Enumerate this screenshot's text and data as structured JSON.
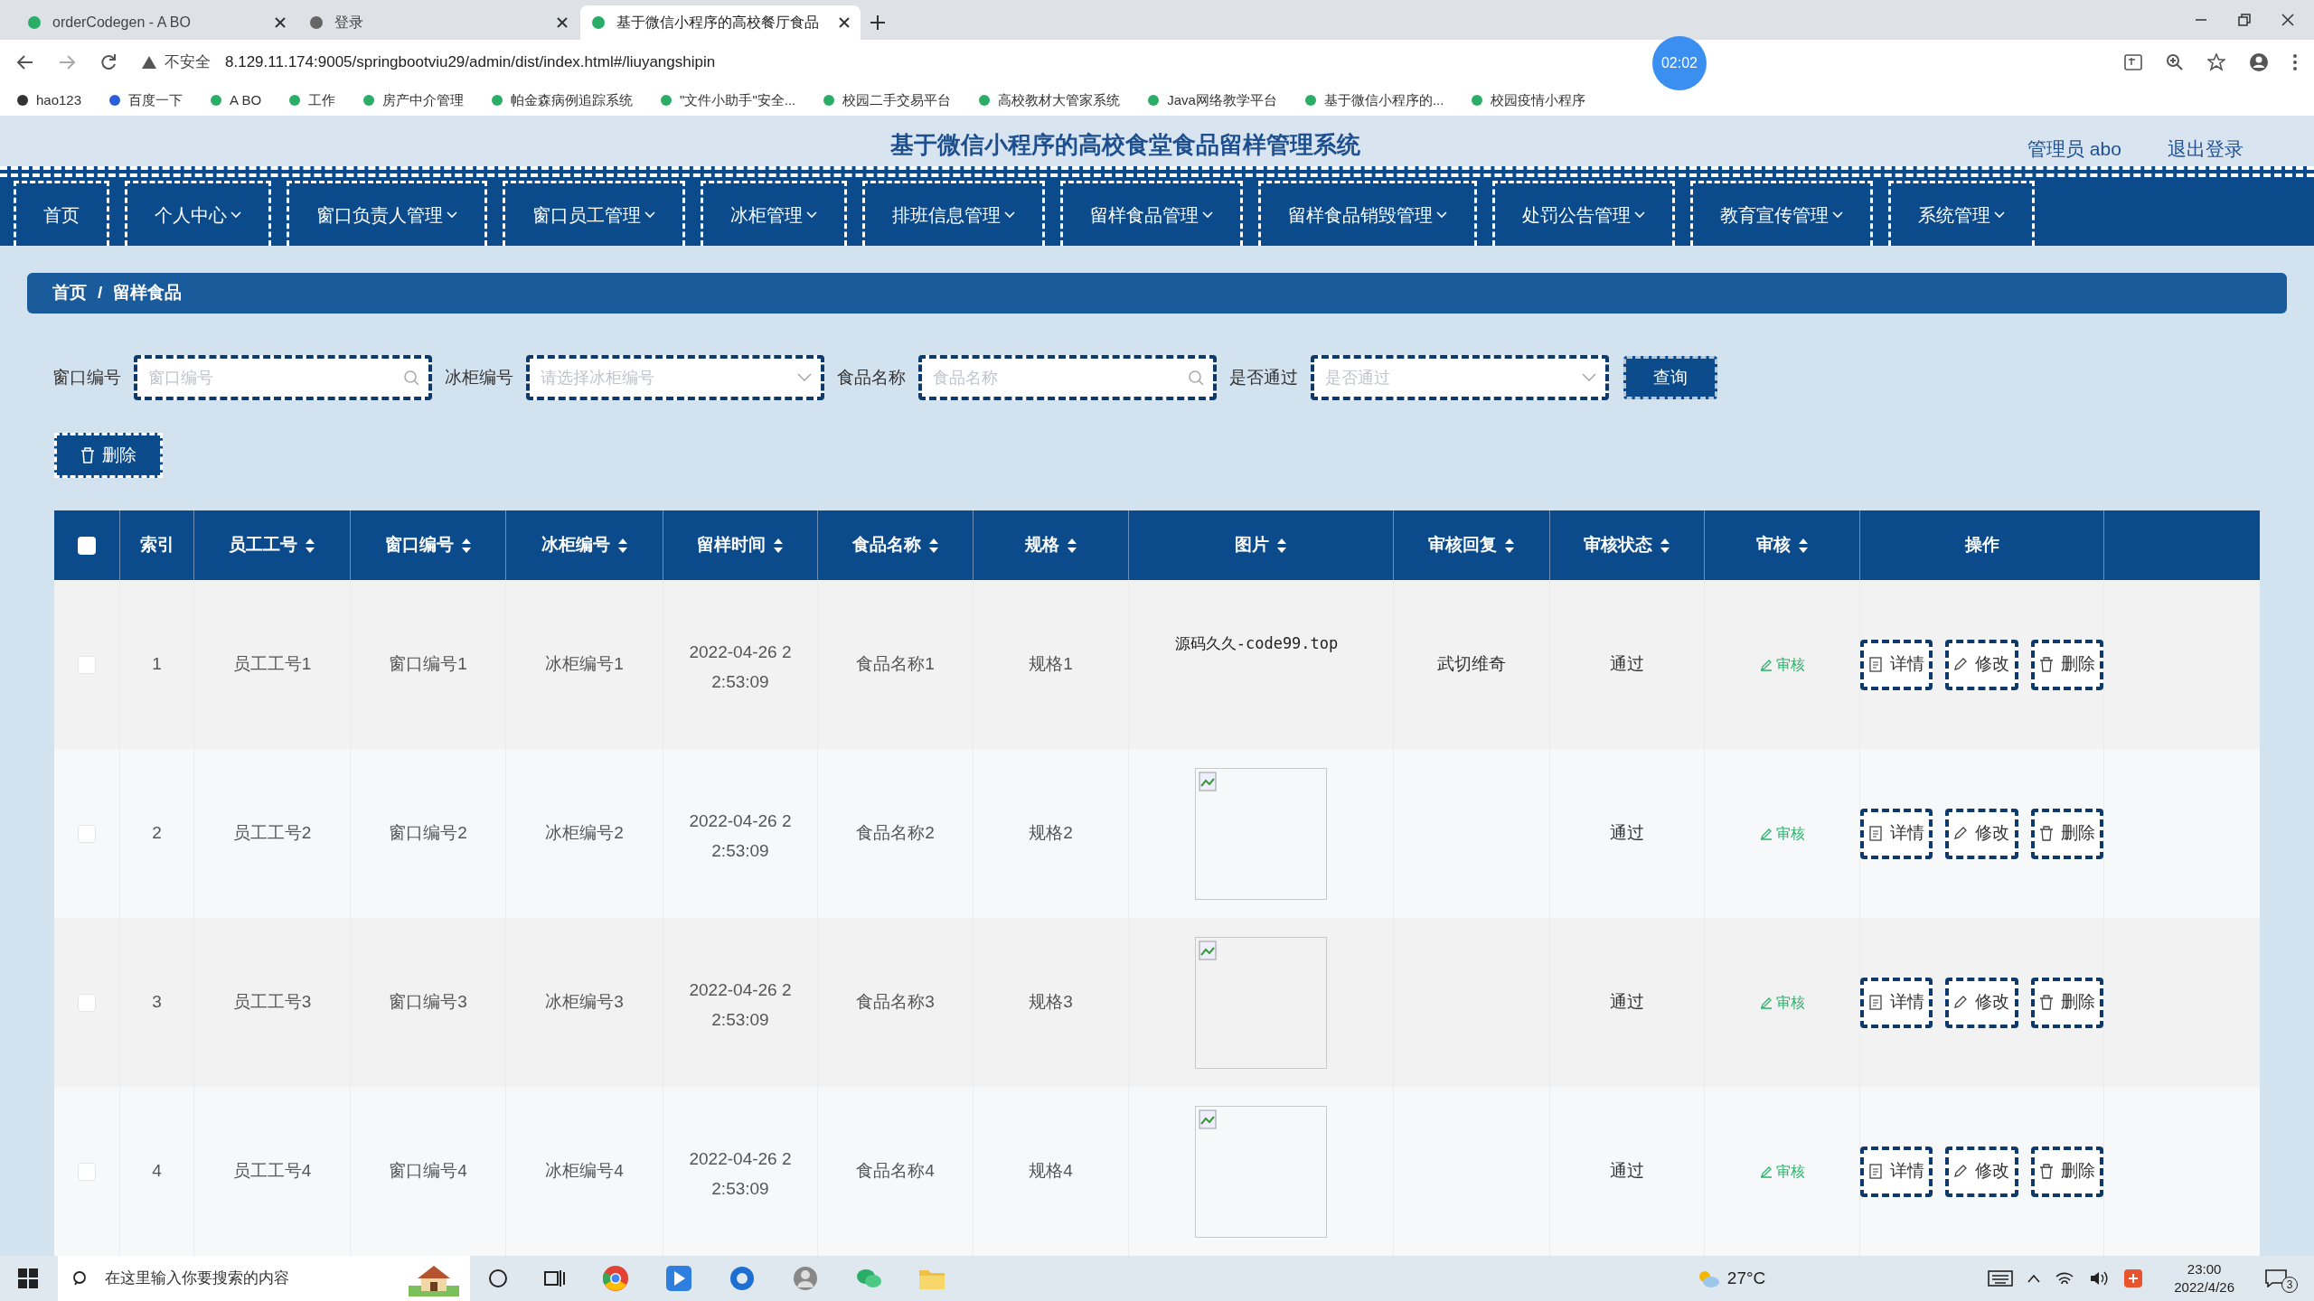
{
  "browser": {
    "tabs": [
      {
        "title": "orderCodegen - A BO",
        "selected": false
      },
      {
        "title": "登录",
        "selected": false
      },
      {
        "title": "基于微信小程序的高校餐厅食品",
        "selected": true
      }
    ],
    "address": {
      "security": "不安全",
      "url": "8.129.11.174:9005/springbootviu29/admin/dist/index.html#/liuyangshipin"
    },
    "timer_badge": "02:02",
    "bookmarks": [
      "hao123",
      "百度一下",
      "A BO",
      "工作",
      "房产中介管理",
      "帕金森病例追踪系统",
      "\"文件小助手\"安全...",
      "校园二手交易平台",
      "高校教材大管家系统",
      "Java网络教学平台",
      "基于微信小程序的...",
      "校园疫情小程序"
    ]
  },
  "header": {
    "title": "基于微信小程序的高校食堂食品留样管理系统",
    "user": "管理员 abo",
    "logout": "退出登录"
  },
  "nav": [
    {
      "label": "首页",
      "has_menu": false
    },
    {
      "label": "个人中心",
      "has_menu": true
    },
    {
      "label": "窗口负责人管理",
      "has_menu": true
    },
    {
      "label": "窗口员工管理",
      "has_menu": true
    },
    {
      "label": "冰柜管理",
      "has_menu": true
    },
    {
      "label": "排班信息管理",
      "has_menu": true
    },
    {
      "label": "留样食品管理",
      "has_menu": true
    },
    {
      "label": "留样食品销毁管理",
      "has_menu": true
    },
    {
      "label": "处罚公告管理",
      "has_menu": true
    },
    {
      "label": "教育宣传管理",
      "has_menu": true
    },
    {
      "label": "系统管理",
      "has_menu": true
    }
  ],
  "breadcrumb": {
    "items": [
      "首页",
      "留样食品"
    ],
    "separator": "/"
  },
  "filters": [
    {
      "label": "窗口编号",
      "placeholder": "窗口编号",
      "kind": "search"
    },
    {
      "label": "冰柜编号",
      "placeholder": "请选择冰柜编号",
      "kind": "select"
    },
    {
      "label": "食品名称",
      "placeholder": "食品名称",
      "kind": "search"
    },
    {
      "label": "是否通过",
      "placeholder": "是否通过",
      "kind": "select"
    }
  ],
  "query_button": "查询",
  "delete_button": "删除",
  "table": {
    "select_all_checked": false,
    "columns": [
      {
        "label": "索引",
        "sortable": false
      },
      {
        "label": "员工工号",
        "sortable": true
      },
      {
        "label": "窗口编号",
        "sortable": true
      },
      {
        "label": "冰柜编号",
        "sortable": true
      },
      {
        "label": "留样时间",
        "sortable": true
      },
      {
        "label": "食品名称",
        "sortable": true
      },
      {
        "label": "规格",
        "sortable": true
      },
      {
        "label": "图片",
        "sortable": true
      },
      {
        "label": "审核回复",
        "sortable": true
      },
      {
        "label": "审核状态",
        "sortable": true
      },
      {
        "label": "审核",
        "sortable": true
      },
      {
        "label": "操作",
        "sortable": false
      }
    ],
    "rows": [
      {
        "checked": false,
        "index": "1",
        "employee": "员工工号1",
        "window": "窗口编号1",
        "fridge": "冰柜编号1",
        "time": "2022-04-26 22:53:09",
        "food": "食品名称1",
        "spec": "规格1",
        "image": {
          "kind": "text",
          "text": "源码久久-code99.top"
        },
        "reply": "武切维奇",
        "status": "通过",
        "review": "审核",
        "actions": [
          "详情",
          "修改",
          "删除"
        ]
      },
      {
        "checked": false,
        "index": "2",
        "employee": "员工工号2",
        "window": "窗口编号2",
        "fridge": "冰柜编号2",
        "time": "2022-04-26 22:53:09",
        "food": "食品名称2",
        "spec": "规格2",
        "image": {
          "kind": "broken"
        },
        "status": "通过",
        "review": "审核",
        "actions": [
          "详情",
          "修改",
          "删除"
        ]
      },
      {
        "checked": false,
        "index": "3",
        "employee": "员工工号3",
        "window": "窗口编号3",
        "fridge": "冰柜编号3",
        "time": "2022-04-26 22:53:09",
        "food": "食品名称3",
        "spec": "规格3",
        "image": {
          "kind": "broken"
        },
        "status": "通过",
        "review": "审核",
        "actions": [
          "详情",
          "修改",
          "删除"
        ]
      },
      {
        "checked": false,
        "index": "4",
        "employee": "员工工号4",
        "window": "窗口编号4",
        "fridge": "冰柜编号4",
        "time": "2022-04-26 22:53:09",
        "food": "食品名称4",
        "spec": "规格4",
        "image": {
          "kind": "broken"
        },
        "status": "通过",
        "review": "审核",
        "actions": [
          "详情",
          "修改",
          "删除"
        ]
      }
    ]
  },
  "taskbar": {
    "search_placeholder": "在这里输入你要搜索的内容",
    "weather": "27°C",
    "time": "23:00",
    "date": "2022/4/26",
    "notifications": "3"
  }
}
